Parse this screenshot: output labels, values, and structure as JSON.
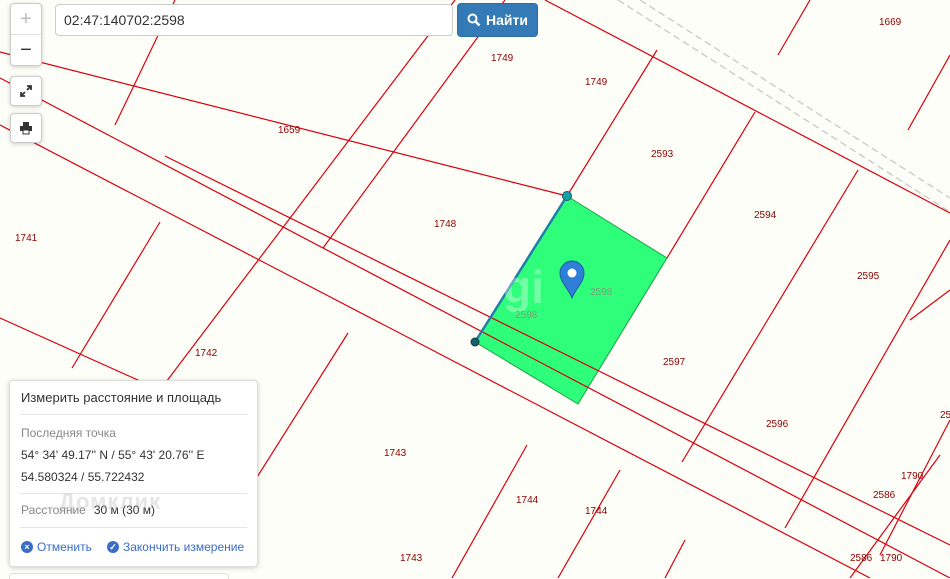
{
  "search": {
    "value": "02:47:140702:2598",
    "button_label": "Найти",
    "icon": "search-icon"
  },
  "controls": {
    "zoom_in": "+",
    "zoom_out": "−",
    "fullscreen_icon": "expand-icon",
    "print_icon": "printer-icon"
  },
  "map": {
    "parcel_labels": [
      "1669",
      "1749",
      "1749",
      "1659",
      "2593",
      "1748",
      "2594",
      "1741",
      "2598",
      "2595",
      "2598",
      "1742",
      "2597",
      "2596",
      "2586",
      "1790",
      "1743",
      "1744",
      "1744",
      "1743",
      "2586",
      "1790",
      "25"
    ],
    "watermark": "gi",
    "colors": {
      "background": "#fefef8",
      "boundary": "#d9000d",
      "selected_parcel": "#2ffe7a",
      "marker": "#2f7fd8"
    },
    "marker_icon": "map-pin-icon"
  },
  "measure_panel": {
    "title": "Измерить расстояние и площадь",
    "last_point_label": "Последняя точка",
    "dms": "54° 34' 49.17'' N / 55° 43' 20.76'' E",
    "decimal": "54.580324 / 55.722432",
    "distance_label": "Расстояние",
    "distance_value": "30 м (30 м)",
    "cancel_label": "Отменить",
    "finish_label": "Закончить измерение",
    "watermark": "Домклик"
  }
}
